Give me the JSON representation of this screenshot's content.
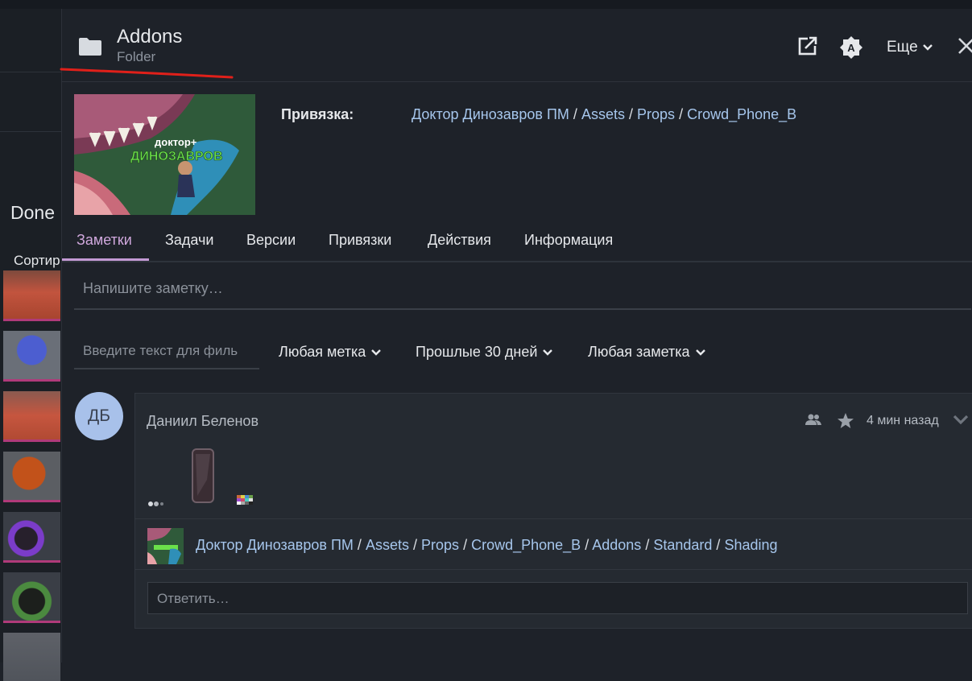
{
  "background": {
    "status_label": "Done",
    "sort_label": "Сортир"
  },
  "header": {
    "title": "Addons",
    "subtitle": "Folder",
    "more_label": "Еще",
    "icons": [
      "folder-icon",
      "open-external-icon",
      "theme-auto-icon",
      "chevron-down-icon",
      "close-icon"
    ]
  },
  "preview": {
    "logo_line1": "доктор+",
    "logo_line2": "ДИНОЗАВРОВ"
  },
  "binding": {
    "label": "Привязка:",
    "crumbs": [
      "Доктор Динозавров ПМ",
      "Assets",
      "Props",
      "Crowd_Phone_B"
    ],
    "separator": "/"
  },
  "tabs": [
    {
      "label": "Заметки",
      "active": true
    },
    {
      "label": "Задачи",
      "active": false
    },
    {
      "label": "Версии",
      "active": false
    },
    {
      "label": "Привязки",
      "active": false
    },
    {
      "label": "Действия",
      "active": false
    },
    {
      "label": "Информация",
      "active": false
    }
  ],
  "note_input": {
    "placeholder": "Напишите заметку…",
    "value": ""
  },
  "filters": {
    "text_placeholder": "Введите текст для филь",
    "tag": "Любая метка",
    "period": "Прошлые 30 дней",
    "note_type": "Любая заметка"
  },
  "note": {
    "avatar_initials": "ДБ",
    "author": "Даниил Беленов",
    "time": "4 мин назад",
    "path": [
      "Доктор Динозавров ПМ",
      "Assets",
      "Props",
      "Crowd_Phone_B",
      "Addons",
      "Standard",
      "Shading"
    ],
    "reply_placeholder": "Ответить…"
  },
  "colors": {
    "accent": "#c39ad4",
    "link": "#a6c6ec",
    "annotation_line": "#e0201a",
    "avatar_bg": "#a8c1ea",
    "background": "#1e2229"
  }
}
